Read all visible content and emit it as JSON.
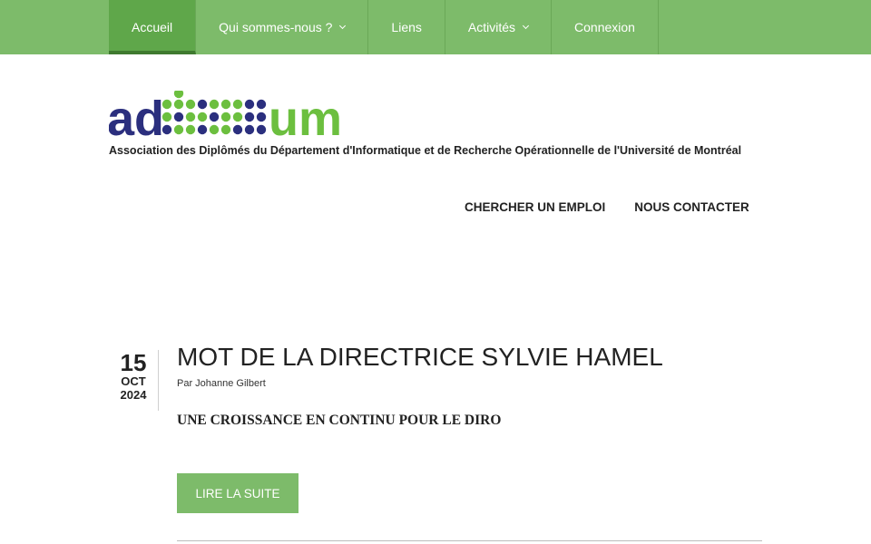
{
  "nav": {
    "items": [
      {
        "label": "Accueil",
        "active": true,
        "has_dropdown": false
      },
      {
        "label": "Qui sommes-nous ?",
        "active": false,
        "has_dropdown": true
      },
      {
        "label": "Liens",
        "active": false,
        "has_dropdown": false
      },
      {
        "label": "Activités",
        "active": false,
        "has_dropdown": true
      },
      {
        "label": "Connexion",
        "active": false,
        "has_dropdown": false
      }
    ]
  },
  "logo": {
    "text_left": "ad",
    "text_right": "um",
    "tagline": "Association des Diplômés du Département d'Informatique et de Recherche Opérationnelle de l'Université de Montréal"
  },
  "secondary_nav": {
    "items": [
      "CHERCHER UN EMPLOI",
      "NOUS CONTACTER"
    ]
  },
  "post": {
    "day": "15",
    "month": "OCT",
    "year": "2024",
    "title": "MOT DE LA DIRECTRICE SYLVIE HAMEL",
    "byline": "Par Johanne Gilbert",
    "excerpt": "UNE CROISSANCE EN CONTINU POUR LE DIRO",
    "read_more": "LIRE LA SUITE"
  },
  "colors": {
    "accent_green": "#7dbb6a",
    "active_green": "#5fa74a",
    "logo_navy": "#2b2f7e",
    "logo_green": "#6cbf3f"
  }
}
